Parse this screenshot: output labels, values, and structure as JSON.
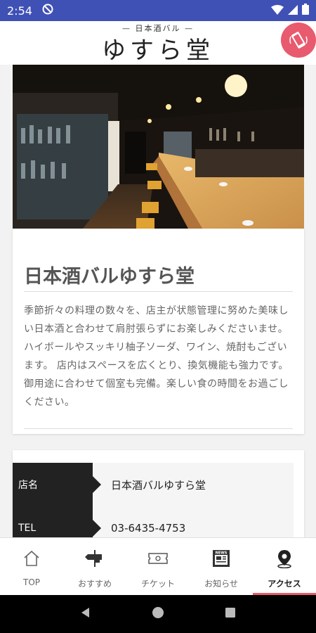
{
  "status_bar": {
    "time": "2:54"
  },
  "header": {
    "logo_sub": "— 日本酒バル —",
    "logo_main": "ゆすら堂"
  },
  "intro": {
    "title": "日本酒バルゆすら堂",
    "text": "季節折々の料理の数々を、店主が状態管理に努めた美味しい日本酒と合わせて肩肘張らずにお楽しみくださいませ。 ハイボールやスッキリ柚子ソーダ、ワイン、焼酎もございます。 店内はスペースを広くとり、換気機能も強力です。御用途に合わせて個室も完備。楽しい食の時間をお過ごしください。"
  },
  "info": {
    "rows": [
      {
        "label": "店名",
        "value": "日本酒バルゆすら堂"
      },
      {
        "label": "TEL",
        "value": "03-6435-4753"
      }
    ]
  },
  "tabs": [
    {
      "label": "TOP",
      "icon": "home-icon"
    },
    {
      "label": "おすすめ",
      "icon": "signpost-icon"
    },
    {
      "label": "チケット",
      "icon": "ticket-icon"
    },
    {
      "label": "お知らせ",
      "icon": "news-icon"
    },
    {
      "label": "アクセス",
      "icon": "map-pin-icon",
      "active": true
    }
  ],
  "colors": {
    "status_bar": "#3f51b5",
    "accent": "#e85a6e",
    "label_bg": "#222222"
  }
}
